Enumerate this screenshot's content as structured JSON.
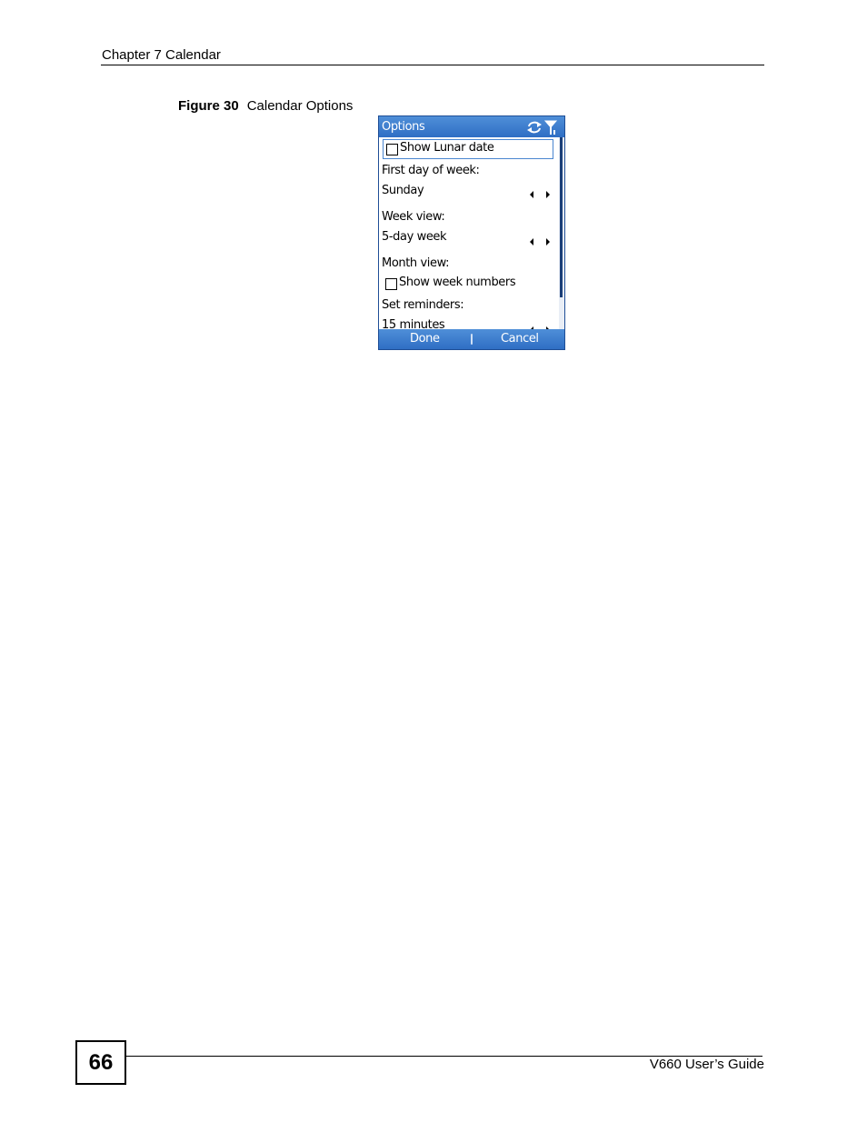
{
  "header": {
    "chapter": "Chapter 7 Calendar"
  },
  "figure": {
    "number": "Figure 30",
    "title": "Calendar Options"
  },
  "screen": {
    "title": "Options",
    "status_icons": [
      "sync-icon",
      "signal-antenna-icon"
    ],
    "show_lunar_date": {
      "label": "Show Lunar date",
      "checked": false
    },
    "first_day_label": "First day of week:",
    "first_day_value": "Sunday",
    "week_view_label": "Week view:",
    "week_view_value": "5-day week",
    "month_view_label": "Month view:",
    "show_week_numbers": {
      "label": "Show week numbers",
      "checked": false
    },
    "reminders_label": "Set reminders:",
    "reminders_value": "15 minutes",
    "softkeys": {
      "left": "Done",
      "right": "Cancel"
    }
  },
  "footer": {
    "page_number": "66",
    "guide": "V660 User’s Guide"
  },
  "colors": {
    "titlebar": "#2f6ec4",
    "focus": "#4a86d0",
    "scroll_thumb": "#1b3f78"
  }
}
